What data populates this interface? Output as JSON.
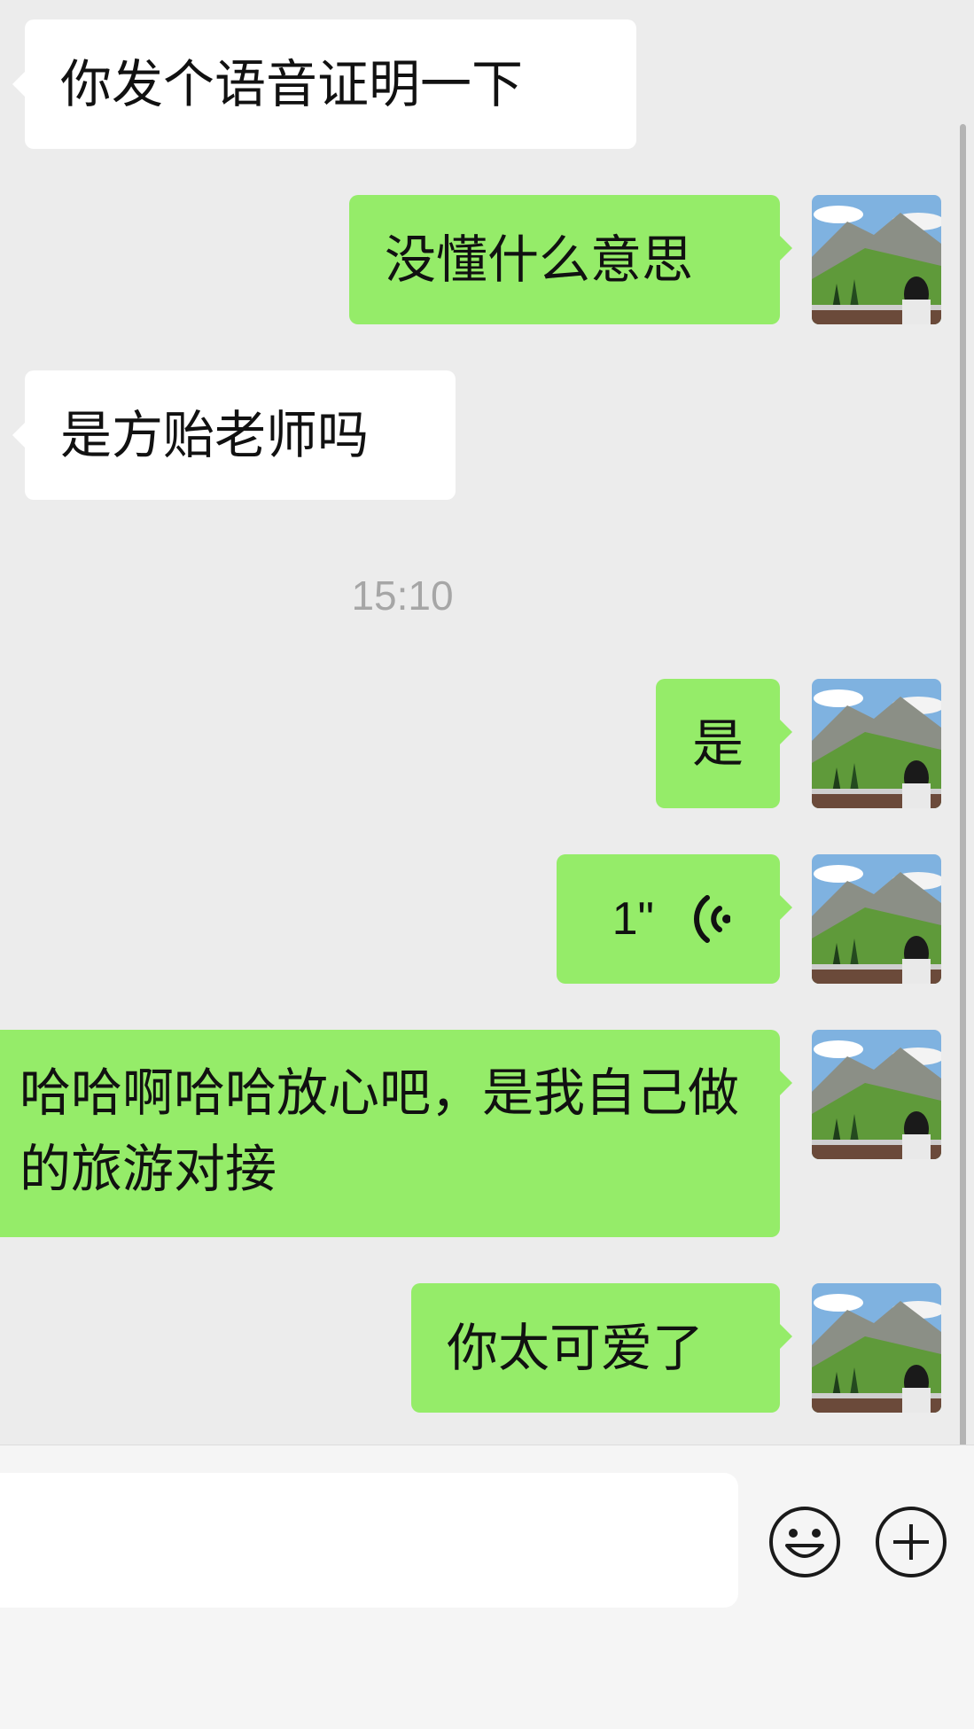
{
  "messages": {
    "m1": "你发个语音证明一下",
    "m2": "没懂什么意思",
    "m3": "是方贻老师吗",
    "timestamp": "15:10",
    "m4": "是",
    "voice_duration": "1\"",
    "m5": "哈哈啊哈哈放心吧，是我自己做的旅游对接",
    "m6": "你太可爱了"
  },
  "icons": {
    "emoji": "emoji-icon",
    "plus": "plus-icon",
    "voice": "voice-wave-icon"
  },
  "colors": {
    "background": "#ececec",
    "bubble_out": "#95ec69",
    "bubble_in": "#ffffff",
    "timestamp": "#a6a6a6"
  },
  "input": {
    "value": ""
  }
}
